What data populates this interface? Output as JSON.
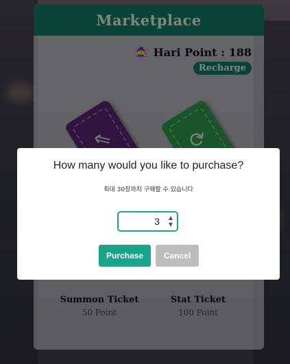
{
  "header": {
    "title": "Marketplace"
  },
  "user": {
    "points_text": "Hari Point : 188",
    "recharge_label": "Recharge"
  },
  "tickets": [
    {
      "name": "Summon Ticket",
      "price": "50 Point",
      "color": "#5c2677",
      "icon": "chevrons-up-left-icon"
    },
    {
      "name": "Stat Ticket",
      "price": "100 Point",
      "color": "#2e9c4a",
      "icon": "refresh-icon"
    }
  ],
  "modal": {
    "title": "How many would you like to purchase?",
    "subtitle": "최대 30장까지 구매할 수 있습니다",
    "quantity": "3",
    "purchase_label": "Purchase",
    "cancel_label": "Cancel"
  },
  "colors": {
    "accent": "#0f7a64",
    "button": "#1aa58a",
    "cancel": "#bdbdbd"
  }
}
